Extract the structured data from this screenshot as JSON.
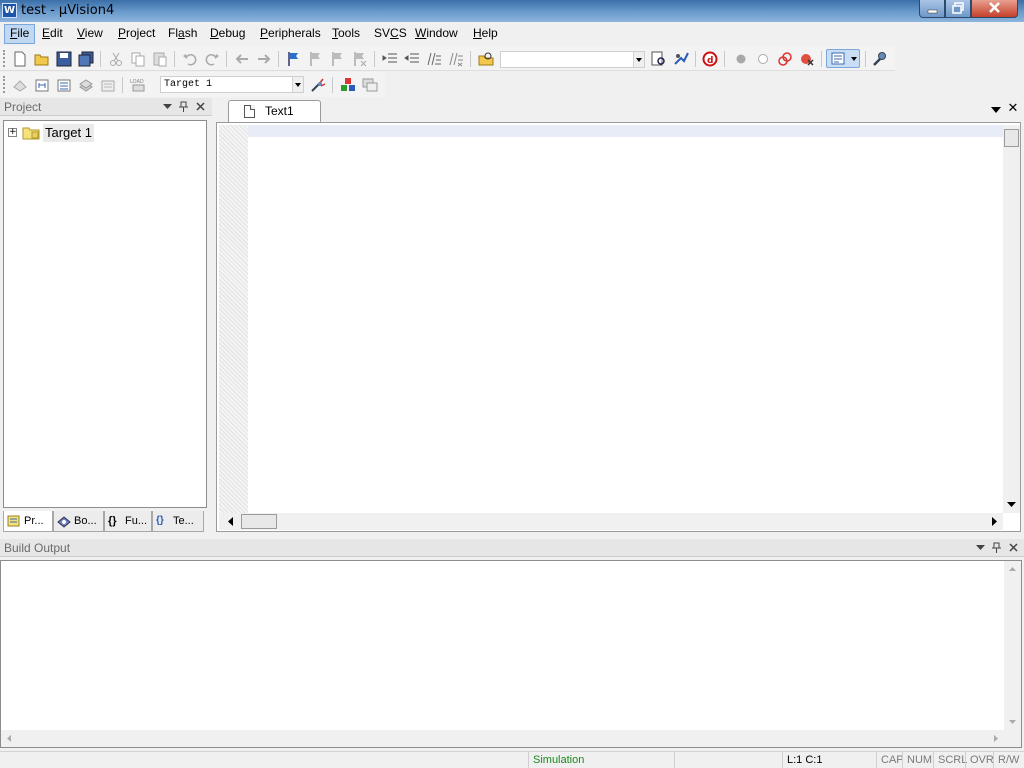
{
  "window": {
    "title": "test  - µVision4",
    "app_icon": "W",
    "buttons": {
      "minimize": "minimize-icon",
      "maximize": "maximize-icon",
      "close": "close-icon"
    }
  },
  "menubar": {
    "items": [
      {
        "label": "File",
        "accel": "F",
        "rest": "ile",
        "active": true
      },
      {
        "label": "Edit",
        "accel": "E",
        "rest": "dit"
      },
      {
        "label": "View",
        "accel": "V",
        "rest": "iew"
      },
      {
        "label": "Project",
        "accel": "P",
        "rest": "roject"
      },
      {
        "label": "Flash",
        "pre": "Fl",
        "accel": "a",
        "rest": "sh"
      },
      {
        "label": "Debug",
        "accel": "D",
        "rest": "ebug"
      },
      {
        "label": "Peripherals",
        "accel": "P",
        "rest": "eripherals"
      },
      {
        "label": "Tools",
        "accel": "T",
        "rest": "ools"
      },
      {
        "label": "SVCS",
        "pre": "SV",
        "accel": "C",
        "rest": "S"
      },
      {
        "label": "Window",
        "accel": "W",
        "rest": "indow"
      },
      {
        "label": "Help",
        "accel": "H",
        "rest": "elp"
      }
    ]
  },
  "toolbar1": {
    "find_combo_value": ""
  },
  "toolbar2": {
    "target_combo_value": "Target 1"
  },
  "project_panel": {
    "title": "Project",
    "tree": [
      {
        "label": "Target 1",
        "expanded": false
      }
    ],
    "tabs": [
      {
        "label": "Pr...",
        "icon": "project-tab-icon",
        "active": true
      },
      {
        "label": "Bo...",
        "icon": "books-tab-icon"
      },
      {
        "label": "Fu...",
        "icon": "functions-tab-icon"
      },
      {
        "label": "Te...",
        "icon": "templates-tab-icon"
      }
    ],
    "tab_icon_text": {
      "functions": "{}",
      "templates": "{}"
    }
  },
  "editor": {
    "tab_label": "Text1",
    "close_glyph": "✕"
  },
  "build_output": {
    "title": "Build Output"
  },
  "statusbar": {
    "mode": "Simulation",
    "position": "L:1 C:1",
    "indicators": [
      "CAP",
      "NUM",
      "SCRL",
      "OVR",
      "R/W"
    ]
  },
  "colors": {
    "titlebar": "#3b6fa8",
    "menu_active": "#c1d8f3",
    "simulation_text": "#1a8a1a"
  }
}
